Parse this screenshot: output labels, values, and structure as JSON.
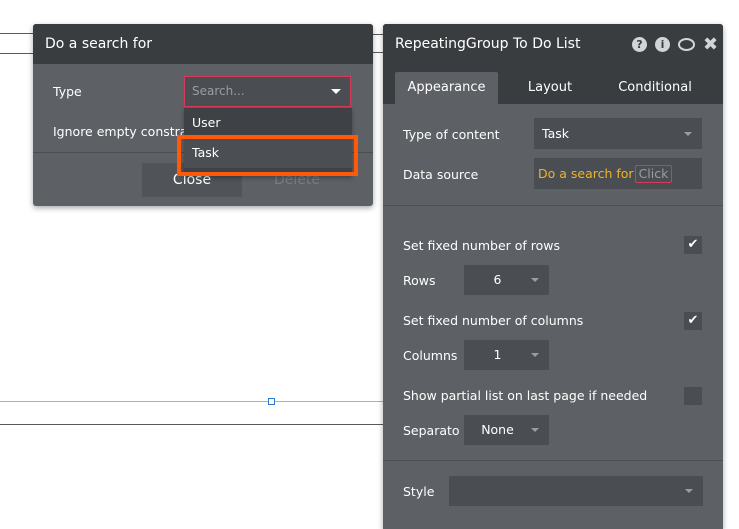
{
  "search_popup": {
    "title": "Do a search for",
    "type_label": "Type",
    "type_placeholder": "Search...",
    "ignore_label": "Ignore empty constraints",
    "close_button": "Close",
    "delete_button": "Delete",
    "dropdown_options": [
      "User",
      "Task"
    ],
    "highlighted_option": "Task"
  },
  "property_editor": {
    "title": "RepeatingGroup To Do List",
    "header_icons": [
      "help-icon",
      "info-icon",
      "comment-icon",
      "close-icon"
    ],
    "help_glyph": "?",
    "info_glyph": "i",
    "close_glyph": "✖",
    "tabs": [
      "Appearance",
      "Layout",
      "Conditional"
    ],
    "active_tab": "Appearance",
    "type_of_content_label": "Type of content",
    "type_of_content_value": "Task",
    "data_source_label": "Data source",
    "data_source_value": "Do a search for",
    "data_source_click": "Click",
    "fixed_rows_label": "Set fixed number of rows",
    "fixed_rows_checked": "✔",
    "rows_label": "Rows",
    "rows_value": "6",
    "fixed_columns_label": "Set fixed number of columns",
    "fixed_columns_checked": "✔",
    "columns_label": "Columns",
    "columns_value": "1",
    "partial_list_label": "Show partial list on last page if needed",
    "separator_label": "Separato",
    "separator_value": "None",
    "style_label": "Style",
    "style_value": ""
  },
  "colors": {
    "highlight": "#ff5a0a",
    "panel_bg": "#5d6064",
    "header_bg": "#3a3d40",
    "data_source_text": "#f0b428"
  }
}
